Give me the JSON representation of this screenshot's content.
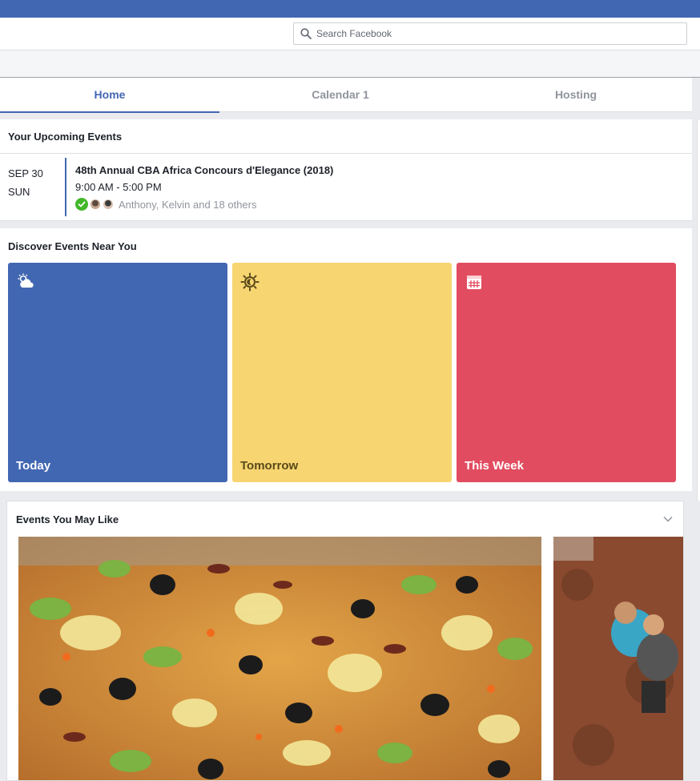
{
  "search": {
    "placeholder": "Search Facebook"
  },
  "tabs": [
    {
      "label": "Home",
      "active": true
    },
    {
      "label": "Calendar 1",
      "active": false
    },
    {
      "label": "Hosting",
      "active": false
    }
  ],
  "upcoming": {
    "title": "Your Upcoming Events",
    "event": {
      "date": "SEP 30",
      "day": "SUN",
      "title": "48th Annual CBA Africa Concours d'Elegance (2018)",
      "time": "9:00 AM - 5:00 PM",
      "guests": "Anthony, Kelvin and 18 others"
    }
  },
  "discover": {
    "title": "Discover Events Near You",
    "tiles": [
      {
        "label": "Today",
        "icon": "weather-icon",
        "color": "#4267b2",
        "text_color": "#ffffff"
      },
      {
        "label": "Tomorrow",
        "icon": "sunrise-icon",
        "color": "#f7d571",
        "text_color": "#5a4a1a"
      },
      {
        "label": "This Week",
        "icon": "calendar-icon",
        "color": "#e24c60",
        "text_color": "#ffffff"
      }
    ]
  },
  "may_like": {
    "title": "Events You May Like"
  },
  "colors": {
    "brand": "#4267b2",
    "going": "#42b72a"
  }
}
